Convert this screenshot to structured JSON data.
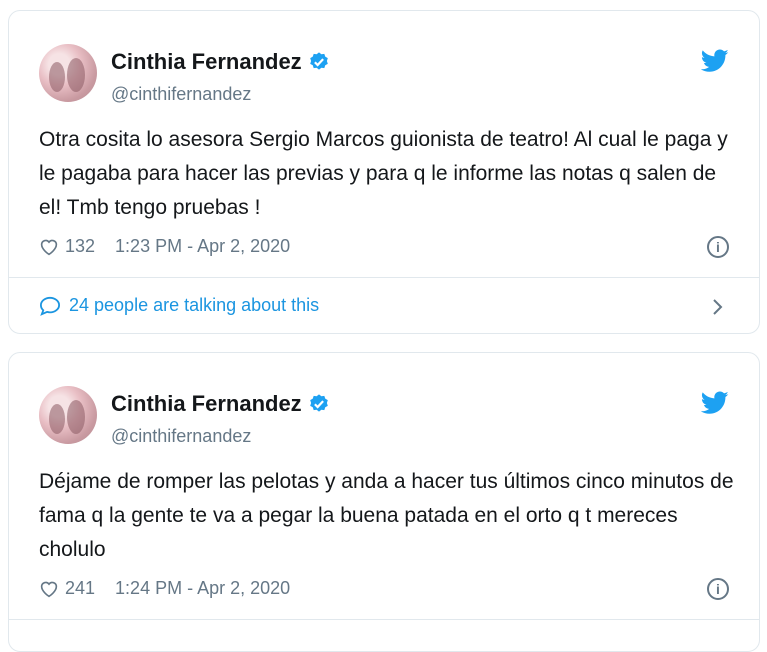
{
  "tweets": [
    {
      "name": "Cinthia Fernandez",
      "handle": "@cinthifernandez",
      "text": "Otra cosita lo asesora Sergio Marcos guionista de teatro! Al cual le paga y le pagaba para hacer las previas y para q le informe las notas q salen de el! Tmb tengo pruebas !",
      "likes": "132",
      "timestamp": "1:23 PM - Apr 2, 2020",
      "talking": "24 people are talking about this"
    },
    {
      "name": "Cinthia Fernandez",
      "handle": "@cinthifernandez",
      "text": "Déjame de romper las pelotas y anda a hacer tus últimos cinco minutos de fama q la gente te va a pegar la buena patada en el orto q t mereces cholulo",
      "likes": "241",
      "timestamp": "1:24 PM - Apr 2, 2020"
    }
  ],
  "colors": {
    "accent": "#1da1f2",
    "link": "#1b95e0",
    "muted": "#657786",
    "border": "#e1e8ed"
  },
  "icons": [
    "verified-icon",
    "twitter-bird-icon",
    "heart-icon",
    "info-icon",
    "comment-bubble-icon",
    "chevron-right-icon"
  ]
}
